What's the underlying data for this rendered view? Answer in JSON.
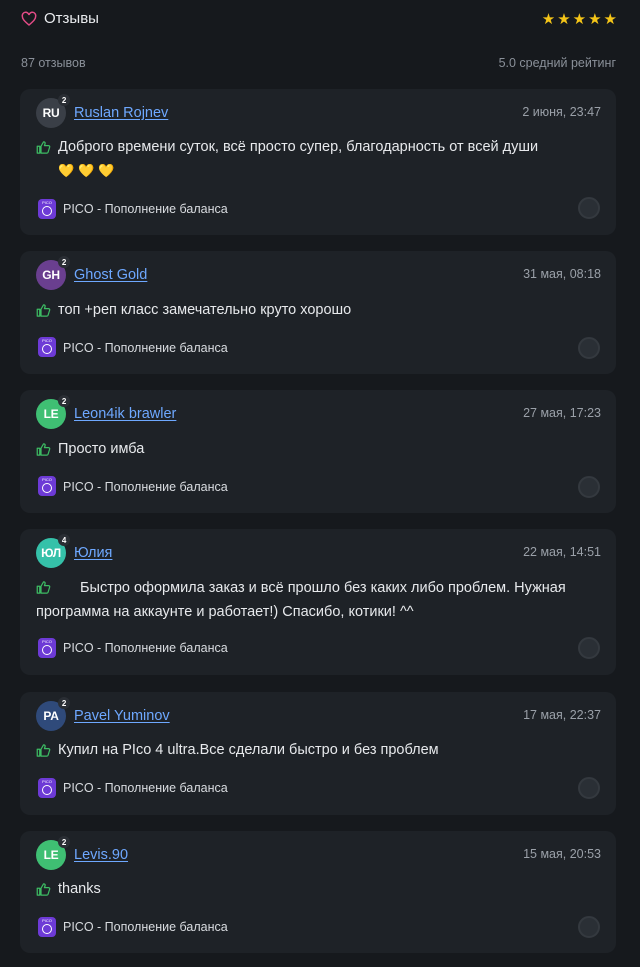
{
  "header": {
    "title": "Отзывы",
    "stars": [
      "★",
      "★",
      "★",
      "★",
      "★"
    ]
  },
  "summary": {
    "count": "87 отзывов",
    "rating": "5.0 средний рейтинг"
  },
  "colors": {
    "accent": "#6ea8ff",
    "star": "#f5c518",
    "product": "#6d3ad6",
    "thumb": "#3dbb63"
  },
  "reviews": [
    {
      "initials": "RU",
      "level": "2",
      "avatar_color": "#3a3f47",
      "name": "Ruslan Rojnev",
      "date": "2 июня, 23:47",
      "line1": "Доброго времени суток, всё просто супер, благодарность от всей души",
      "emoji": "💛💛💛",
      "product": "PICO - Пополнение баланса"
    },
    {
      "initials": "GH",
      "level": "2",
      "avatar_color": "#6a3f8f",
      "name": "Ghost Gold",
      "date": "31 мая, 08:18",
      "line1": "топ +реп класс замечательно круто хорошо",
      "product": "PICO - Пополнение баланса"
    },
    {
      "initials": "LE",
      "level": "2",
      "avatar_color": "#3fbf73",
      "name": "Leon4ik brawler",
      "date": "27 мая, 17:23",
      "line1": "Просто имба",
      "product": "PICO - Пополнение баланса"
    },
    {
      "initials": "ЮЛ",
      "level": "4",
      "avatar_color": "#35c1a9",
      "name": "Юлия",
      "date": "22 мая, 14:51",
      "line1": "Быстро оформила заказ и всё прошло без каких либо проблем. Нужная",
      "line2": "программа на аккаунте и работает!) Спасибо, котики! ^^",
      "product": "PICO - Пополнение баланса"
    },
    {
      "initials": "PA",
      "level": "2",
      "avatar_color": "#2f4a7a",
      "name": "Pavel Yuminov",
      "date": "17 мая, 22:37",
      "line1": "Купил на PIco 4 ultra.Все сделали быстро и без проблем",
      "product": "PICO - Пополнение баланса"
    },
    {
      "initials": "LE",
      "level": "2",
      "avatar_color": "#3fbf73",
      "name": "Levis.90",
      "date": "15 мая, 20:53",
      "line1": "thanks",
      "product": "PICO - Пополнение баланса"
    }
  ]
}
